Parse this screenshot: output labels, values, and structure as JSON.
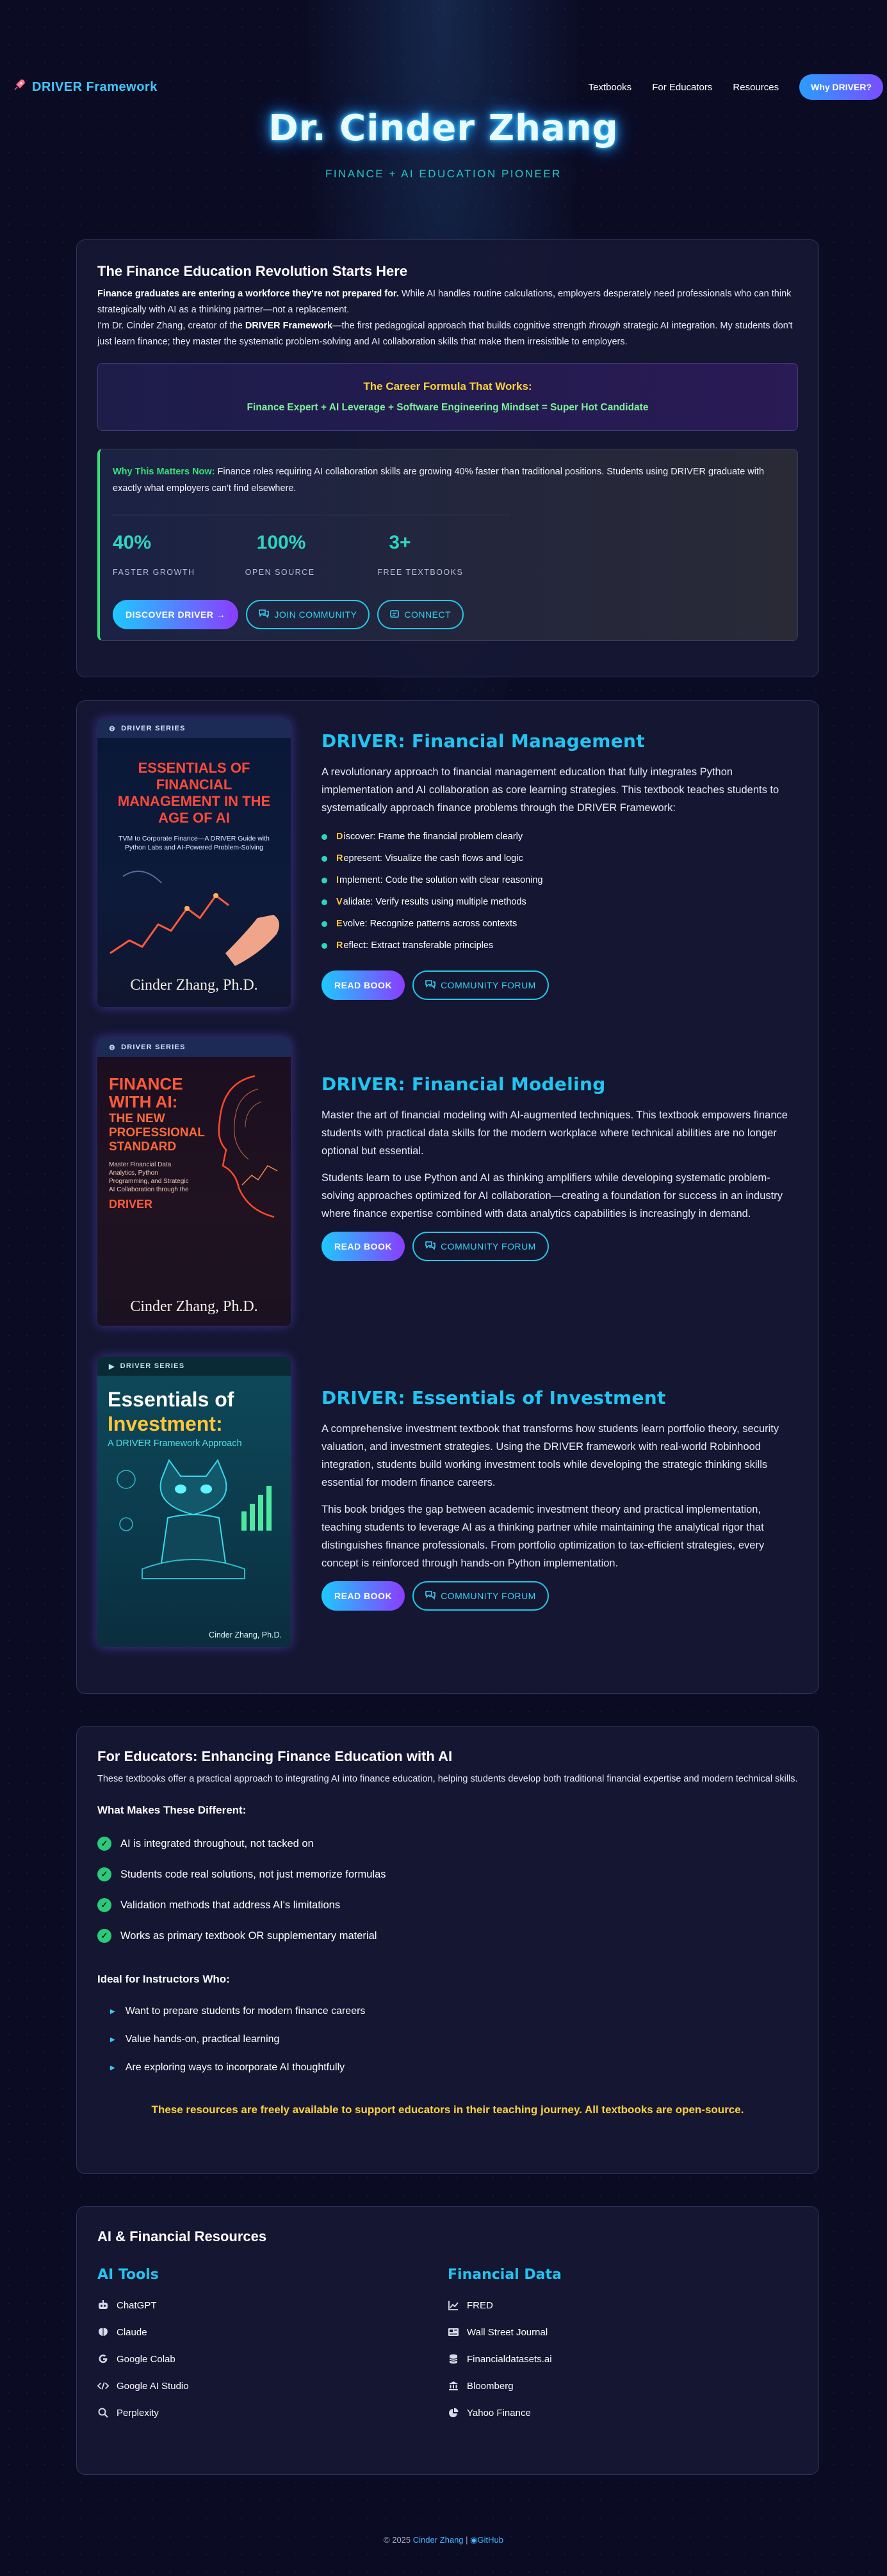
{
  "nav": {
    "brand": "DRIVER Framework",
    "links": [
      "Textbooks",
      "For Educators",
      "Resources"
    ],
    "cta": "Why DRIVER?"
  },
  "hero": {
    "title": "Dr. Cinder Zhang",
    "subtitle": "FINANCE + AI EDUCATION PIONEER"
  },
  "intro": {
    "heading": "The Finance Education Revolution Starts Here",
    "p1_bold": "Finance graduates are entering a workforce they're not prepared for.",
    "p1_rest": " While AI handles routine calculations, employers desperately need professionals who can think strategically with AI as a thinking partner—not a replacement.",
    "p2_a": "I'm Dr. Cinder Zhang, creator of the ",
    "p2_bold": "DRIVER Framework",
    "p2_b": "—the first pedagogical approach that builds cognitive strength ",
    "p2_em": "through",
    "p2_c": " strategic AI integration. My students don't just learn finance; they master the systematic problem-solving and AI collaboration skills that make them irresistible to employers.",
    "formula_title": "The Career Formula That Works:",
    "formula_text": "Finance Expert + AI Leverage + Software Engineering Mindset = Super Hot Candidate",
    "why_label": "Why This Matters Now:",
    "why_text": " Finance roles requiring AI collaboration skills are growing 40% faster than traditional positions. Students using DRIVER graduate with exactly what employers can't find elsewhere.",
    "stats": [
      {
        "value": "40%",
        "label": "FASTER GROWTH"
      },
      {
        "value": "100%",
        "label": "OPEN SOURCE"
      },
      {
        "value": "3+",
        "label": "FREE TEXTBOOKS"
      }
    ],
    "btn_discover": "DISCOVER DRIVER →",
    "btn_community": "JOIN COMMUNITY",
    "btn_connect": "CONNECT"
  },
  "books": [
    {
      "title": "DRIVER: Financial Management",
      "desc": "A revolutionary approach to financial management education that fully integrates Python implementation and AI collaboration as core learning strategies. This textbook teaches students to systematically approach finance problems through the DRIVER Framework:",
      "steps": [
        {
          "letter": "D",
          "text": "iscover: Frame the financial problem clearly"
        },
        {
          "letter": "R",
          "text": "epresent: Visualize the cash flows and logic"
        },
        {
          "letter": "I",
          "text": "mplement: Code the solution with clear reasoning"
        },
        {
          "letter": "V",
          "text": "alidate: Verify results using multiple methods"
        },
        {
          "letter": "E",
          "text": "volve: Recognize patterns across contexts"
        },
        {
          "letter": "R",
          "text": "eflect: Extract transferable principles"
        }
      ],
      "read": "READ BOOK",
      "forum": "COMMUNITY FORUM",
      "cover": {
        "series": "DRIVER SERIES",
        "title": "ESSENTIALS OF FINANCIAL MANAGEMENT IN THE AGE OF AI",
        "subtitle": "TVM to Corporate Finance—A DRIVER Guide with Python Labs and AI-Powered Problem-Solving",
        "author": "Cinder Zhang, Ph.D."
      }
    },
    {
      "title": "DRIVER: Financial Modeling",
      "p1": "Master the art of financial modeling with AI-augmented techniques. This textbook empowers finance students with practical data skills for the modern workplace where technical abilities are no longer optional but essential.",
      "p2": "Students learn to use Python and AI as thinking amplifiers while developing systematic problem-solving approaches optimized for AI collaboration—creating a foundation for success in an industry where finance expertise combined with data analytics capabilities is increasingly in demand.",
      "read": "READ BOOK",
      "forum": "COMMUNITY FORUM",
      "cover": {
        "series": "DRIVER SERIES",
        "title": "FINANCE WITH AI:",
        "title2": "THE NEW PROFESSIONAL STANDARD",
        "subtitle": "Master Financial Data Analytics, Python Programming, and Strategic AI Collaboration through the",
        "driver": "DRIVER",
        "author": "Cinder Zhang, Ph.D."
      }
    },
    {
      "title": "DRIVER: Essentials of Investment",
      "p1": "A comprehensive investment textbook that transforms how students learn portfolio theory, security valuation, and investment strategies. Using the DRIVER framework with real-world Robinhood integration, students build working investment tools while developing the strategic thinking skills essential for modern finance careers.",
      "p2": "This book bridges the gap between academic investment theory and practical implementation, teaching students to leverage AI as a thinking partner while maintaining the analytical rigor that distinguishes finance professionals. From portfolio optimization to tax-efficient strategies, every concept is reinforced through hands-on Python implementation.",
      "read": "READ BOOK",
      "forum": "COMMUNITY FORUM",
      "cover": {
        "series": "DRIVER SERIES",
        "title1": "Essentials of",
        "title2": "Investment:",
        "subtitle": "A DRIVER Framework Approach",
        "author": "Cinder Zhang, Ph.D."
      }
    }
  ],
  "educators": {
    "heading": "For Educators: Enhancing Finance Education with AI",
    "intro": "These textbooks offer a practical approach to integrating AI into finance education, helping students develop both traditional financial expertise and modern technical skills.",
    "diff_heading": "What Makes These Different:",
    "diff_items": [
      "AI is integrated throughout, not tacked on",
      "Students code real solutions, not just memorize formulas",
      "Validation methods that address AI's limitations",
      "Works as primary textbook OR supplementary material"
    ],
    "ideal_heading": "Ideal for Instructors Who:",
    "ideal_items": [
      "Want to prepare students for modern finance careers",
      "Value hands-on, practical learning",
      "Are exploring ways to incorporate AI thoughtfully"
    ],
    "footer": "These resources are freely available to support educators in their teaching journey. All textbooks are open-source."
  },
  "resources": {
    "heading": "AI & Financial Resources",
    "ai_heading": "AI Tools",
    "ai_items": [
      {
        "label": "ChatGPT",
        "icon": "robot-icon"
      },
      {
        "label": "Claude",
        "icon": "brain-icon"
      },
      {
        "label": "Google Colab",
        "icon": "google-icon"
      },
      {
        "label": "Google AI Studio",
        "icon": "code-icon"
      },
      {
        "label": "Perplexity",
        "icon": "search-icon"
      }
    ],
    "data_heading": "Financial Data",
    "data_items": [
      {
        "label": "FRED",
        "icon": "chart-line-icon"
      },
      {
        "label": "Wall Street Journal",
        "icon": "newspaper-icon"
      },
      {
        "label": "Financialdatasets.ai",
        "icon": "database-icon"
      },
      {
        "label": "Bloomberg",
        "icon": "bank-icon"
      },
      {
        "label": "Yahoo Finance",
        "icon": "pie-chart-icon"
      }
    ]
  },
  "footer": {
    "copyright": "© 2025 ",
    "author": "Cinder Zhang",
    "sep": " | ",
    "github": "GitHub"
  }
}
